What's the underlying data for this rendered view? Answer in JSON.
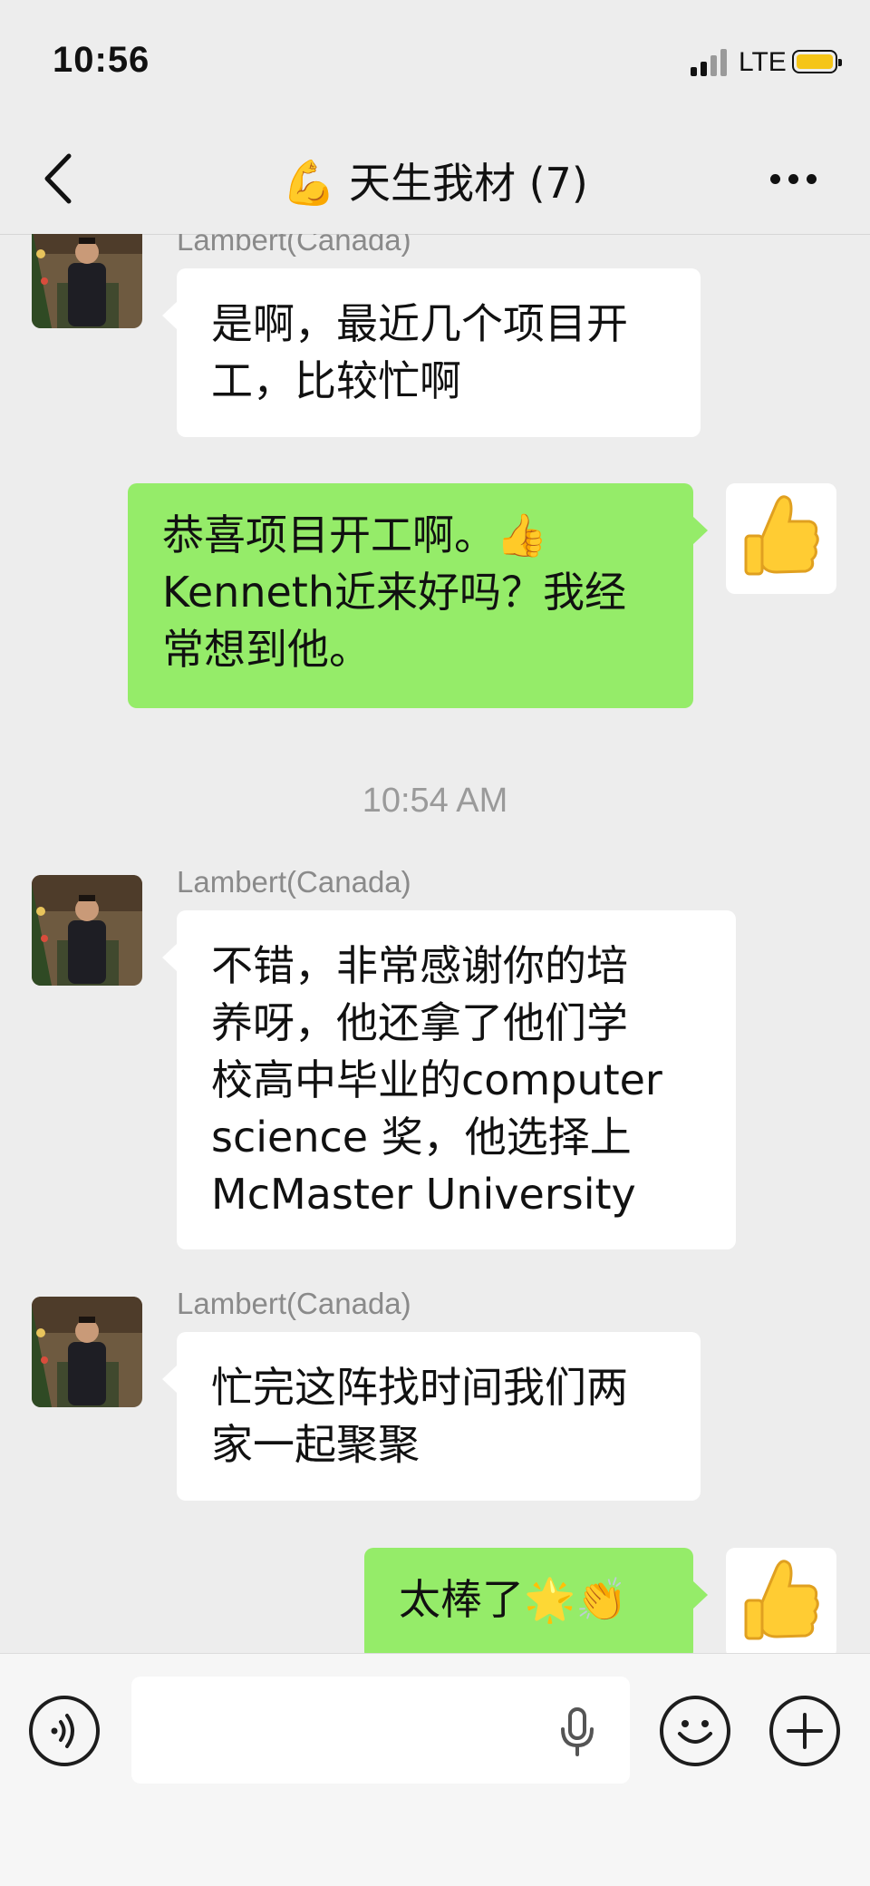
{
  "status_bar": {
    "time": "10:56",
    "network": "LTE"
  },
  "header": {
    "title_emoji": "💪",
    "title": "天生我材 (7)"
  },
  "messages": [
    {
      "sender": "Lambert(Canada)",
      "lines": [
        "是啊，最近几个项目开",
        "工，比较忙啊"
      ]
    },
    {
      "lines": [
        "恭喜项目开工啊。👍",
        "Kenneth近来好吗？我经",
        "常想到他。"
      ]
    },
    {
      "timestamp": "10:54 AM"
    },
    {
      "sender": "Lambert(Canada)",
      "lines": [
        "不错，非常感谢你的培",
        "养呀，他还拿了他们学",
        "校高中毕业的computer",
        "science 奖，他选择上",
        "McMaster University"
      ]
    },
    {
      "sender": "Lambert(Canada)",
      "lines": [
        "忙完这阵找时间我们两",
        "家一起聚聚"
      ]
    },
    {
      "lines": [
        "太棒了🌟👏"
      ]
    }
  ],
  "icons": {
    "back": "chevron-left-icon",
    "more": "more-dots-icon",
    "voice": "voice-input-icon",
    "mic": "microphone-icon",
    "emoji": "emoji-icon",
    "plus": "plus-icon",
    "thumbs_up_avatar": "thumbs-up-icon"
  },
  "colors": {
    "background": "#ededed",
    "sent_bubble": "#95ec69",
    "received_bubble": "#ffffff",
    "battery": "#f5c518"
  }
}
